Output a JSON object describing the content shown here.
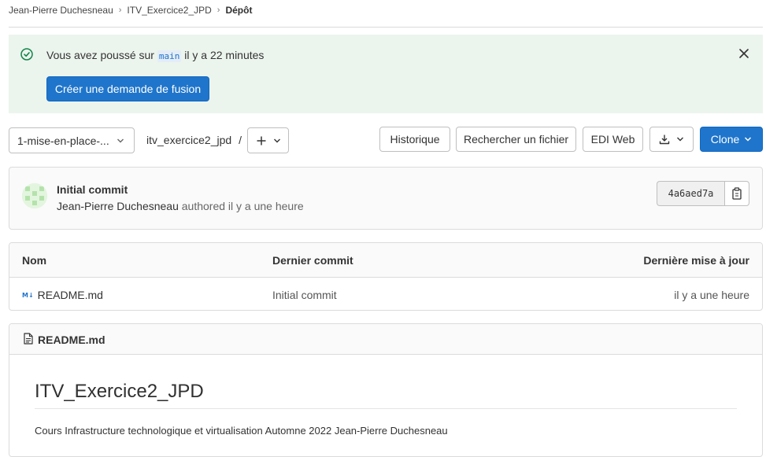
{
  "breadcrumb": {
    "items": [
      "Jean-Pierre Duchesneau",
      "ITV_Exercice2_JPD"
    ],
    "current": "Dépôt"
  },
  "alert": {
    "msg_prefix": "Vous avez poussé sur",
    "branch": "main",
    "msg_suffix": "il y a 22 minutes",
    "button": "Créer une demande de fusion"
  },
  "toolbar": {
    "branch": "1-mise-en-place-...",
    "path": "itv_exercice2_jpd",
    "path_sep": "/",
    "history": "Historique",
    "find_file": "Rechercher un fichier",
    "web_ide": "EDI Web",
    "clone": "Clone"
  },
  "commit": {
    "title": "Initial commit",
    "author": "Jean-Pierre Duchesneau",
    "meta": "authored il y a une heure",
    "sha": "4a6aed7a"
  },
  "tree": {
    "headers": [
      "Nom",
      "Dernier commit",
      "Dernière mise à jour"
    ],
    "rows": [
      {
        "icon_text": "M↓",
        "name": "README.md",
        "commit": "Initial commit",
        "updated": "il y a une heure"
      }
    ]
  },
  "readme": {
    "filename": "README.md",
    "title": "ITV_Exercice2_JPD",
    "body": "Cours Infrastructure technologique et virtualisation Automne 2022 Jean-Pierre Duchesneau"
  },
  "colors": {
    "primary": "#1f75cb",
    "alert_bg": "#ecf4ee",
    "success": "#108548"
  }
}
